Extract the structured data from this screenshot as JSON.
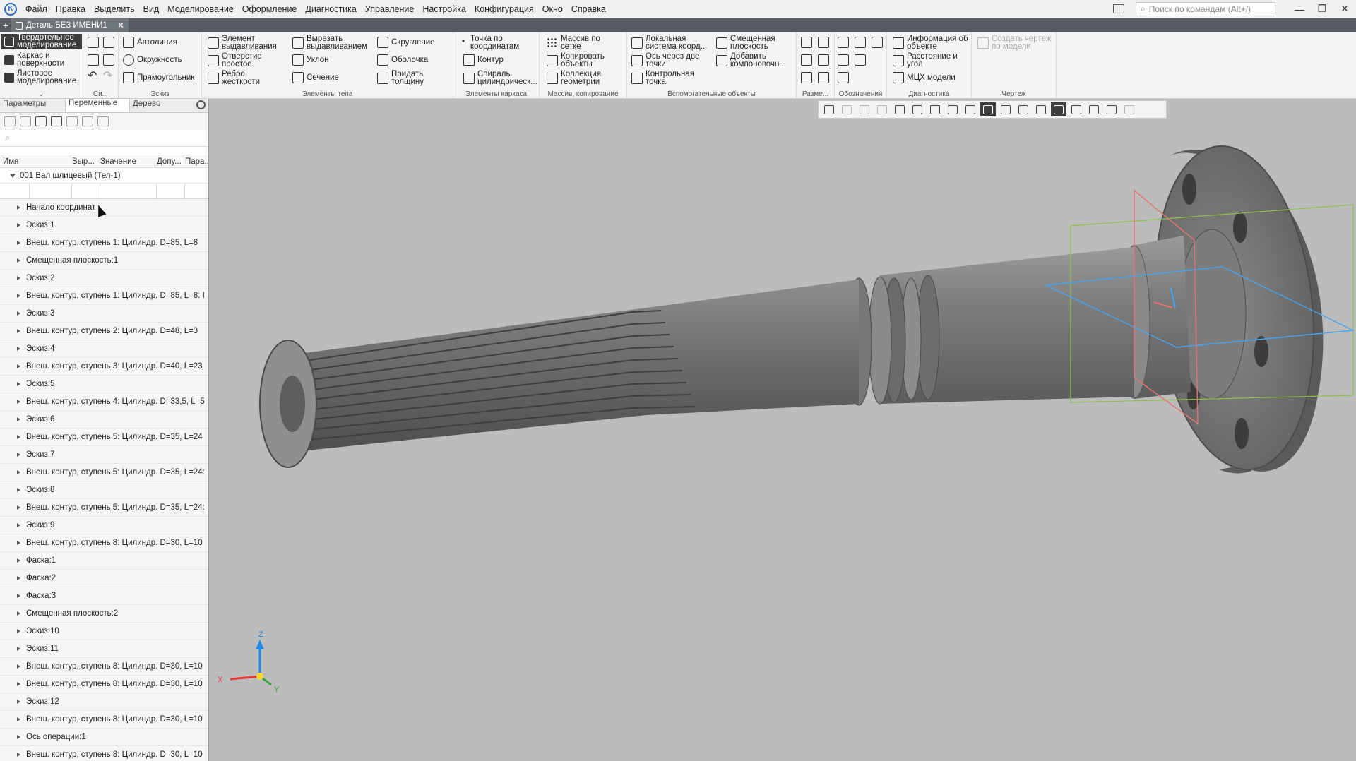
{
  "menubar": {
    "items": [
      "Файл",
      "Правка",
      "Выделить",
      "Вид",
      "Моделирование",
      "Оформление",
      "Диагностика",
      "Управление",
      "Настройка",
      "Конфигурация",
      "Окно",
      "Справка"
    ],
    "search_placeholder": "Поиск по командам (Alt+/)"
  },
  "tabbar": {
    "doc_title": "Деталь БЕЗ ИМЕНИ1"
  },
  "ribbon": {
    "modes": {
      "solid": "Твердотельное моделирование",
      "frame": "Каркас и поверхности",
      "sheet": "Листовое моделирование"
    },
    "sketch": {
      "autoline": "Автолиния",
      "circle": "Окружность",
      "rectangle": "Прямоугольник"
    },
    "body": {
      "extrude": "Элемент выдавливания",
      "hole": "Отверстие простое",
      "rib": "Ребро жесткости",
      "cut_extrude": "Вырезать выдавливанием",
      "draft": "Уклон",
      "section": "Сечение",
      "fillet": "Скругление",
      "shell": "Оболочка",
      "thicken": "Придать толщину"
    },
    "frame": {
      "point": "Точка по координатам",
      "contour": "Контур",
      "spiral": "Спираль цилиндрическ..."
    },
    "arrays": {
      "grid_array": "Массив по сетке",
      "copy_objects": "Копировать объекты",
      "geom_collection": "Коллекция геометрии"
    },
    "aux": {
      "local_cs": "Локальная система коорд...",
      "axis_2pts": "Ось через две точки",
      "control_point": "Контрольная точка",
      "offset_plane": "Смещенная плоскость",
      "add_layout": "Добавить компоновочн..."
    },
    "diag": {
      "obj_info": "Информация об объекте",
      "dist_angle": "Расстояние и угол",
      "mcx": "МЦХ модели"
    },
    "drawing": {
      "create_drawing": "Создать чертеж по модели"
    },
    "group_labels": {
      "sys": "Си...",
      "sketch": "Эскиз",
      "body": "Элементы тела",
      "frame": "Элементы каркаса",
      "arrays": "Массив, копирование",
      "aux": "Вспомогательные объекты",
      "dims": "Разме...",
      "notes": "Обозначения",
      "diag": "Диагностика",
      "drawing": "Чертеж"
    }
  },
  "panel": {
    "tabs": [
      "Параметры",
      "Переменные",
      "Дерево"
    ],
    "active_tab": "Переменные",
    "columns": [
      "Имя",
      "Выр...",
      "Значение",
      "Допу...",
      "Пара..."
    ],
    "root": "001 Вал шлицевый (Тел-1)",
    "rows": [
      "Начало координат",
      "Эскиз:1",
      "Внеш. контур, ступень 1: Цилиндр. D=85, L=8",
      "Смещенная плоскость:1",
      "Эскиз:2",
      "Внеш. контур, ступень 1: Цилиндр. D=85, L=8: I",
      "Эскиз:3",
      "Внеш. контур, ступень 2: Цилиндр. D=48, L=3",
      "Эскиз:4",
      "Внеш. контур, ступень 3: Цилиндр. D=40, L=23",
      "Эскиз:5",
      "Внеш. контур, ступень 4: Цилиндр. D=33,5, L=5",
      "Эскиз:6",
      "Внеш. контур, ступень 5: Цилиндр. D=35, L=24",
      "Эскиз:7",
      "Внеш. контур, ступень 5: Цилиндр. D=35, L=24:",
      "Эскиз:8",
      "Внеш. контур, ступень 5: Цилиндр. D=35, L=24:",
      "Эскиз:9",
      "Внеш. контур, ступень 8: Цилиндр. D=30, L=10",
      "Фаска:1",
      "Фаска:2",
      "Фаска:3",
      "Смещенная плоскость:2",
      "Эскиз:10",
      "Эскиз:11",
      "Внеш. контур, ступень 8: Цилиндр. D=30, L=10",
      "Внеш. контур, ступень 8: Цилиндр. D=30, L=10",
      "Эскиз:12",
      "Внеш. контур, ступень 8: Цилиндр. D=30, L=10",
      "Ось операции:1",
      "Внеш. контур, ступень 8: Цилиндр. D=30, L=10"
    ]
  },
  "viewport": {
    "axes": {
      "x": "X",
      "y": "Y",
      "z": "Z"
    },
    "colors": {
      "background": "#bcbcbc",
      "x_axis": "#e53935",
      "y_axis": "#43a047",
      "z_axis": "#1e88e5",
      "plane_red": "#e57373",
      "plane_green": "#8bc34a",
      "plane_blue": "#42a5f5"
    }
  }
}
